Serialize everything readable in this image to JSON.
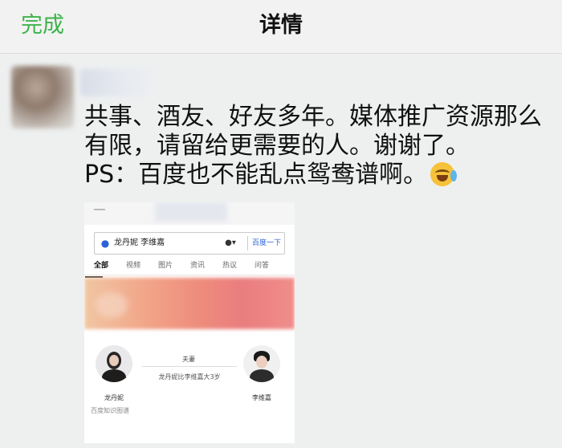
{
  "nav": {
    "done_label": "完成",
    "title": "详情"
  },
  "post": {
    "lines": [
      "共事、酒友、好友多年。媒体推广资源那么",
      "有限，请留给更需要的人。谢谢了。",
      "PS：百度也不能乱点鸳鸯谱啊。"
    ],
    "emoji_icon": "laughing-crying-emoji"
  },
  "screenshot": {
    "search": {
      "icon": "baidu-paw-icon",
      "query": "龙丹妮 李维嘉",
      "mic_icon": "mic-icon",
      "button_label": "百度一下"
    },
    "tabs": [
      "全部",
      "视频",
      "图片",
      "资讯",
      "热议",
      "问答"
    ],
    "relation": {
      "title": "夫妻",
      "description": "龙丹妮比李维嘉大3岁",
      "left_name": "龙丹妮",
      "right_name": "李维嘉",
      "source": "百度知识图谱"
    }
  },
  "colors": {
    "accent_green": "#3cb34a",
    "baidu_blue": "#2d62d6"
  }
}
